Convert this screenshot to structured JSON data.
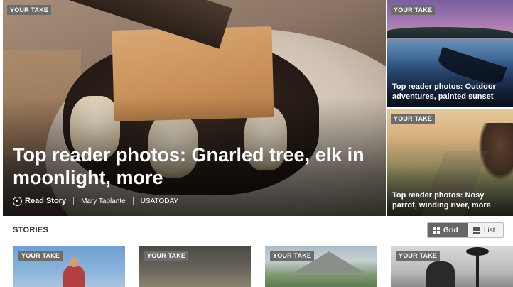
{
  "hero": {
    "tag": "YOUR TAKE",
    "title": "Top reader photos: Gnarled tree, elk in moonlight, more",
    "read_label": "Read Story",
    "author": "Mary Tablante",
    "source": "USATODAY"
  },
  "side_cards": [
    {
      "tag": "YOUR TAKE",
      "title": "Top reader photos: Outdoor adventures, painted sunset"
    },
    {
      "tag": "YOUR TAKE",
      "title": "Top reader photos: Nosy parrot, winding river, more"
    }
  ],
  "stories": {
    "label": "STORIES",
    "view_toggle": {
      "grid_label": "Grid",
      "list_label": "List",
      "selected": "Grid"
    },
    "thumbs": [
      {
        "tag": "YOUR TAKE"
      },
      {
        "tag": "YOUR TAKE"
      },
      {
        "tag": "YOUR TAKE"
      },
      {
        "tag": "YOUR TAKE"
      }
    ]
  },
  "colors": {
    "tag_bg": "#6b6b6b",
    "toggle_active": "#666666"
  }
}
